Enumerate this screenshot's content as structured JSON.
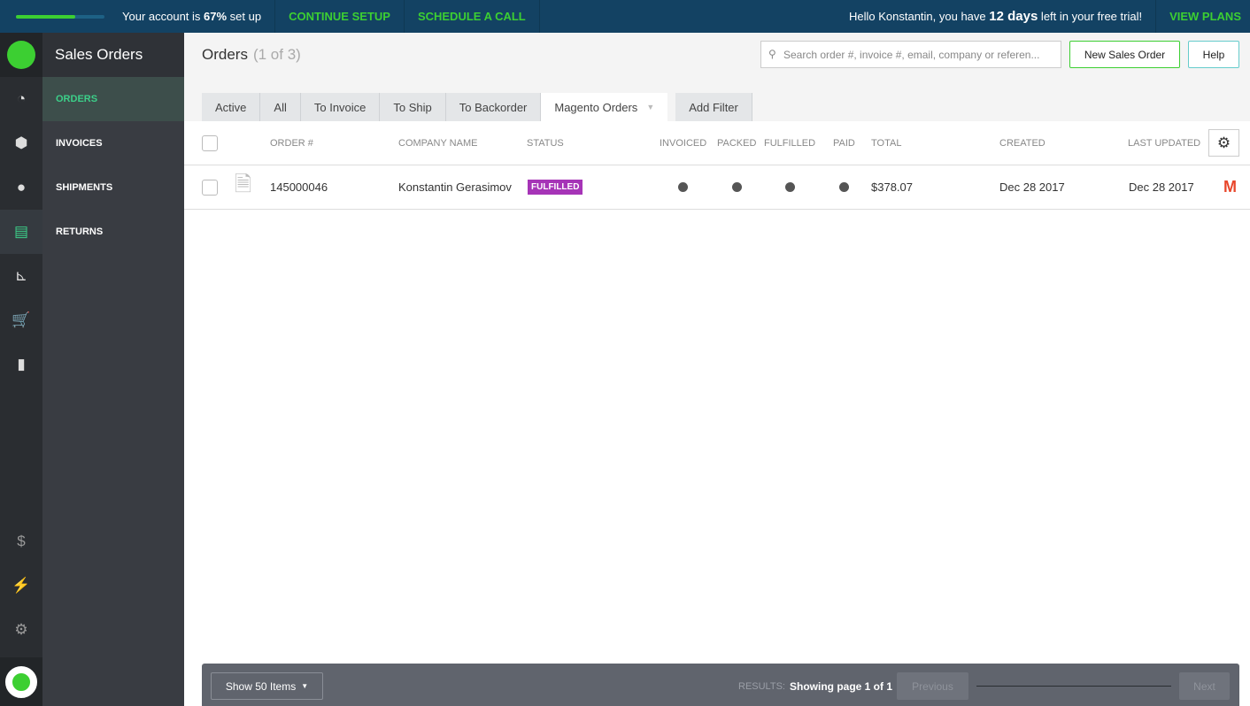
{
  "banner": {
    "setup_progress": 67,
    "setup_prefix": "Your account is ",
    "setup_pct": "67%",
    "setup_suffix": " set up",
    "continue": "CONTINUE SETUP",
    "schedule": "SCHEDULE A CALL",
    "greet_prefix": "Hello Konstantin, you have ",
    "days": "12 days",
    "greet_suffix": " left in your free trial!",
    "view_plans": "VIEW PLANS"
  },
  "sidebar": {
    "title": "Sales Orders",
    "items": [
      {
        "label": "ORDERS"
      },
      {
        "label": "INVOICES"
      },
      {
        "label": "SHIPMENTS"
      },
      {
        "label": "RETURNS"
      }
    ]
  },
  "header": {
    "title": "Orders",
    "count": "(1 of 3)",
    "search_placeholder": "Search order #, invoice #, email, company or referen...",
    "new_order": "New Sales Order",
    "help": "Help"
  },
  "tabs": [
    "Active",
    "All",
    "To Invoice",
    "To Ship",
    "To Backorder",
    "Magento Orders"
  ],
  "add_filter": "Add Filter",
  "columns": [
    "ORDER #",
    "COMPANY NAME",
    "STATUS",
    "INVOICED",
    "PACKED",
    "FULFILLED",
    "PAID",
    "TOTAL",
    "CREATED",
    "LAST UPDATED"
  ],
  "rows": [
    {
      "order": "145000046",
      "company": "Konstantin Gerasimov",
      "status": "FULFILLED",
      "total": "$378.07",
      "created": "Dec 28 2017",
      "updated": "Dec 28 2017"
    }
  ],
  "footer": {
    "show": "Show 50 Items",
    "results": "RESULTS:",
    "page": "Showing page 1 of 1",
    "prev": "Previous",
    "next": "Next"
  }
}
